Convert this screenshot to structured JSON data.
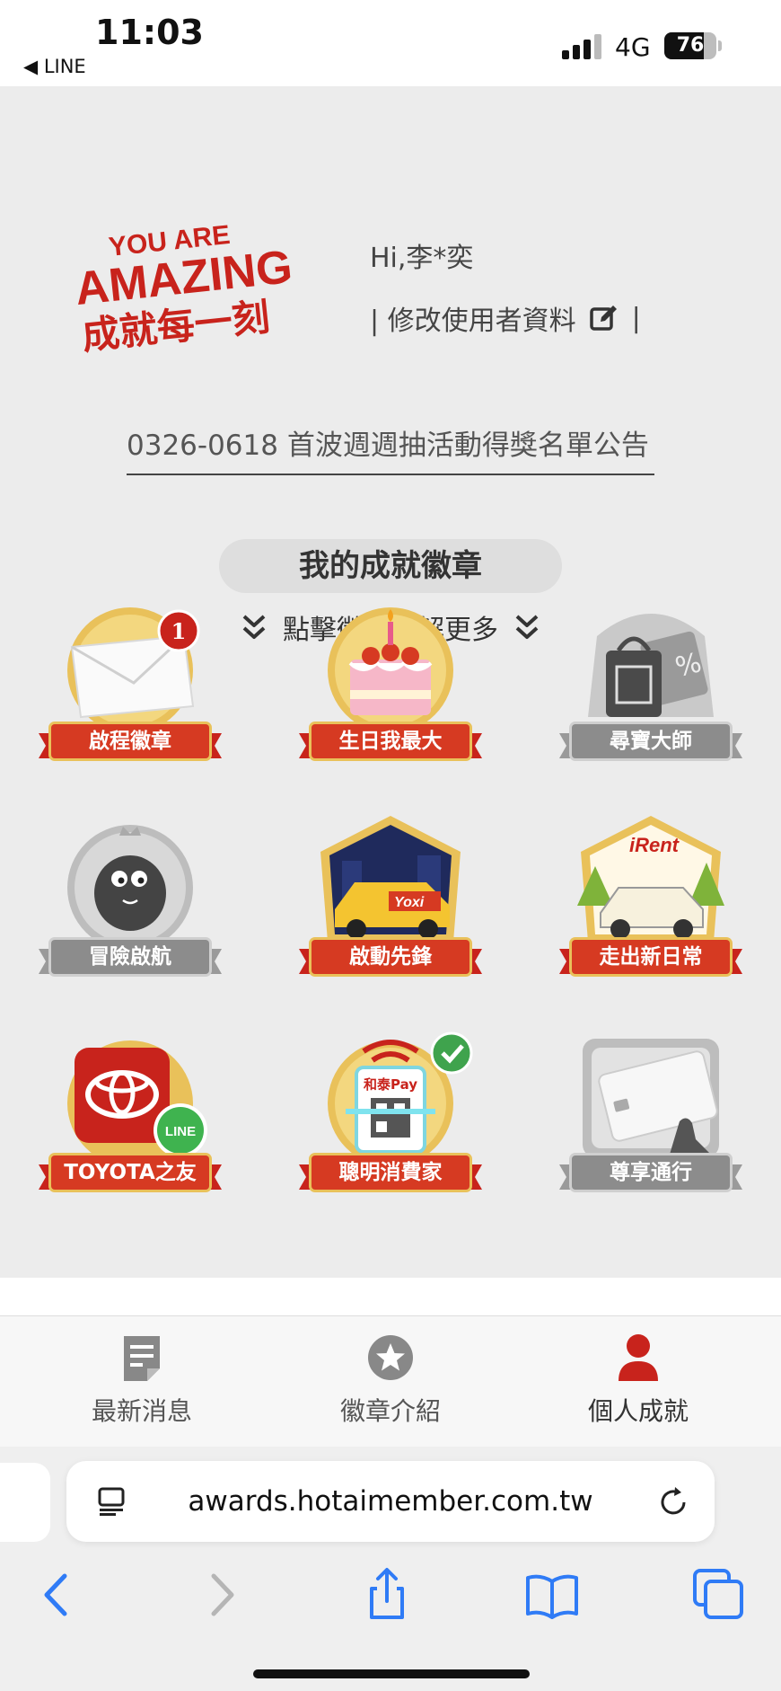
{
  "status_bar": {
    "time": "11:03",
    "back_app": "◀ LINE",
    "network": "4G",
    "battery_level": 76,
    "battery_text": "76"
  },
  "header": {
    "logo_line1": "YOU ARE",
    "logo_line2": "AMAZING",
    "logo_line3": "成就每一刻",
    "greeting": "Hi,李*奕",
    "edit_profile": "| 修改使用者資料",
    "edit_suffix": "|"
  },
  "announcement": "0326-0618 首波週週抽活動得獎名單公告",
  "badges_section": {
    "title": "我的成就徽章",
    "hint": "點擊徽章瞭解更多"
  },
  "badges": [
    {
      "label": "啟程徽章",
      "unlocked": true,
      "notification_count": "1"
    },
    {
      "label": "生日我最大",
      "unlocked": true
    },
    {
      "label": "尋寶大師",
      "unlocked": false
    },
    {
      "label": "冒險啟航",
      "unlocked": false
    },
    {
      "label": "啟動先鋒",
      "unlocked": true
    },
    {
      "label": "走出新日常",
      "unlocked": true,
      "brand_text": "iRent"
    },
    {
      "label": "TOYOTA之友",
      "unlocked": true,
      "brand_text": "LINE"
    },
    {
      "label": "聰明消費家",
      "unlocked": true,
      "brand_text": "和泰Pay"
    },
    {
      "label": "尊享通行",
      "unlocked": false
    }
  ],
  "tabbar": [
    {
      "label": "最新消息",
      "icon": "news-icon"
    },
    {
      "label": "徽章介紹",
      "icon": "star-badge-icon"
    },
    {
      "label": "個人成就",
      "icon": "person-icon",
      "active": true
    }
  ],
  "browser": {
    "url": "awards.hotaimember.com.tw"
  },
  "colors": {
    "brand_red": "#c8231c",
    "badge_red": "#d63a22",
    "gold": "#e9c15a",
    "ios_blue": "#2f7bf6",
    "locked_gray": "#8c8c8c"
  }
}
